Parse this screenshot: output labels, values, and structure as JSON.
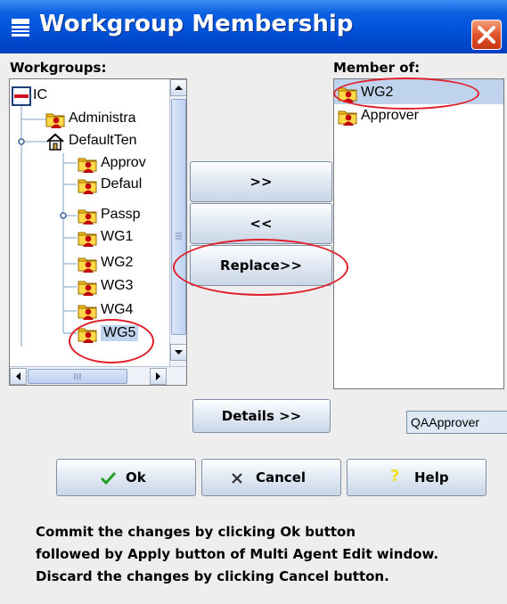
{
  "window": {
    "title": "Workgroup Membership"
  },
  "workgroups": {
    "label": "Workgroups:",
    "tree": [
      {
        "label": "IC",
        "icon": "root-node-icon"
      },
      {
        "label": "Administra",
        "icon": "workgroup-icon"
      },
      {
        "label": "DefaultTen",
        "icon": "home-icon"
      },
      {
        "label": "Approv",
        "icon": "workgroup-icon"
      },
      {
        "label": "Defaul",
        "icon": "workgroup-icon"
      },
      {
        "label": "Passp",
        "icon": "workgroup-icon"
      },
      {
        "label": "WG1",
        "icon": "workgroup-icon"
      },
      {
        "label": "WG2",
        "icon": "workgroup-icon"
      },
      {
        "label": "WG3",
        "icon": "workgroup-icon"
      },
      {
        "label": "WG4",
        "icon": "workgroup-icon"
      },
      {
        "label": "WG5",
        "icon": "workgroup-icon",
        "selected": true
      }
    ]
  },
  "member_of": {
    "label": "Member of:",
    "items": [
      {
        "label": "WG2",
        "icon": "workgroup-icon",
        "selected": true
      },
      {
        "label": "Approver",
        "icon": "workgroup-icon"
      }
    ]
  },
  "actions": {
    "add": ">>",
    "remove": "<<",
    "replace": "Replace>>",
    "details": "Details >>"
  },
  "side_item": "QAApprover",
  "buttons": {
    "ok": "Ok",
    "cancel": "Cancel",
    "help": "Help"
  },
  "footer": [
    "Commit the changes by clicking Ok button",
    "followed by Apply button of Multi Agent Edit window.",
    "Discard the changes by clicking Cancel button."
  ],
  "colors": {
    "title_bar": "#0051d8",
    "selection": "#c0d3ec",
    "annotation_red": "#e0202a",
    "ok_check": "#1fa01f",
    "help_mark": "#f0e020"
  }
}
